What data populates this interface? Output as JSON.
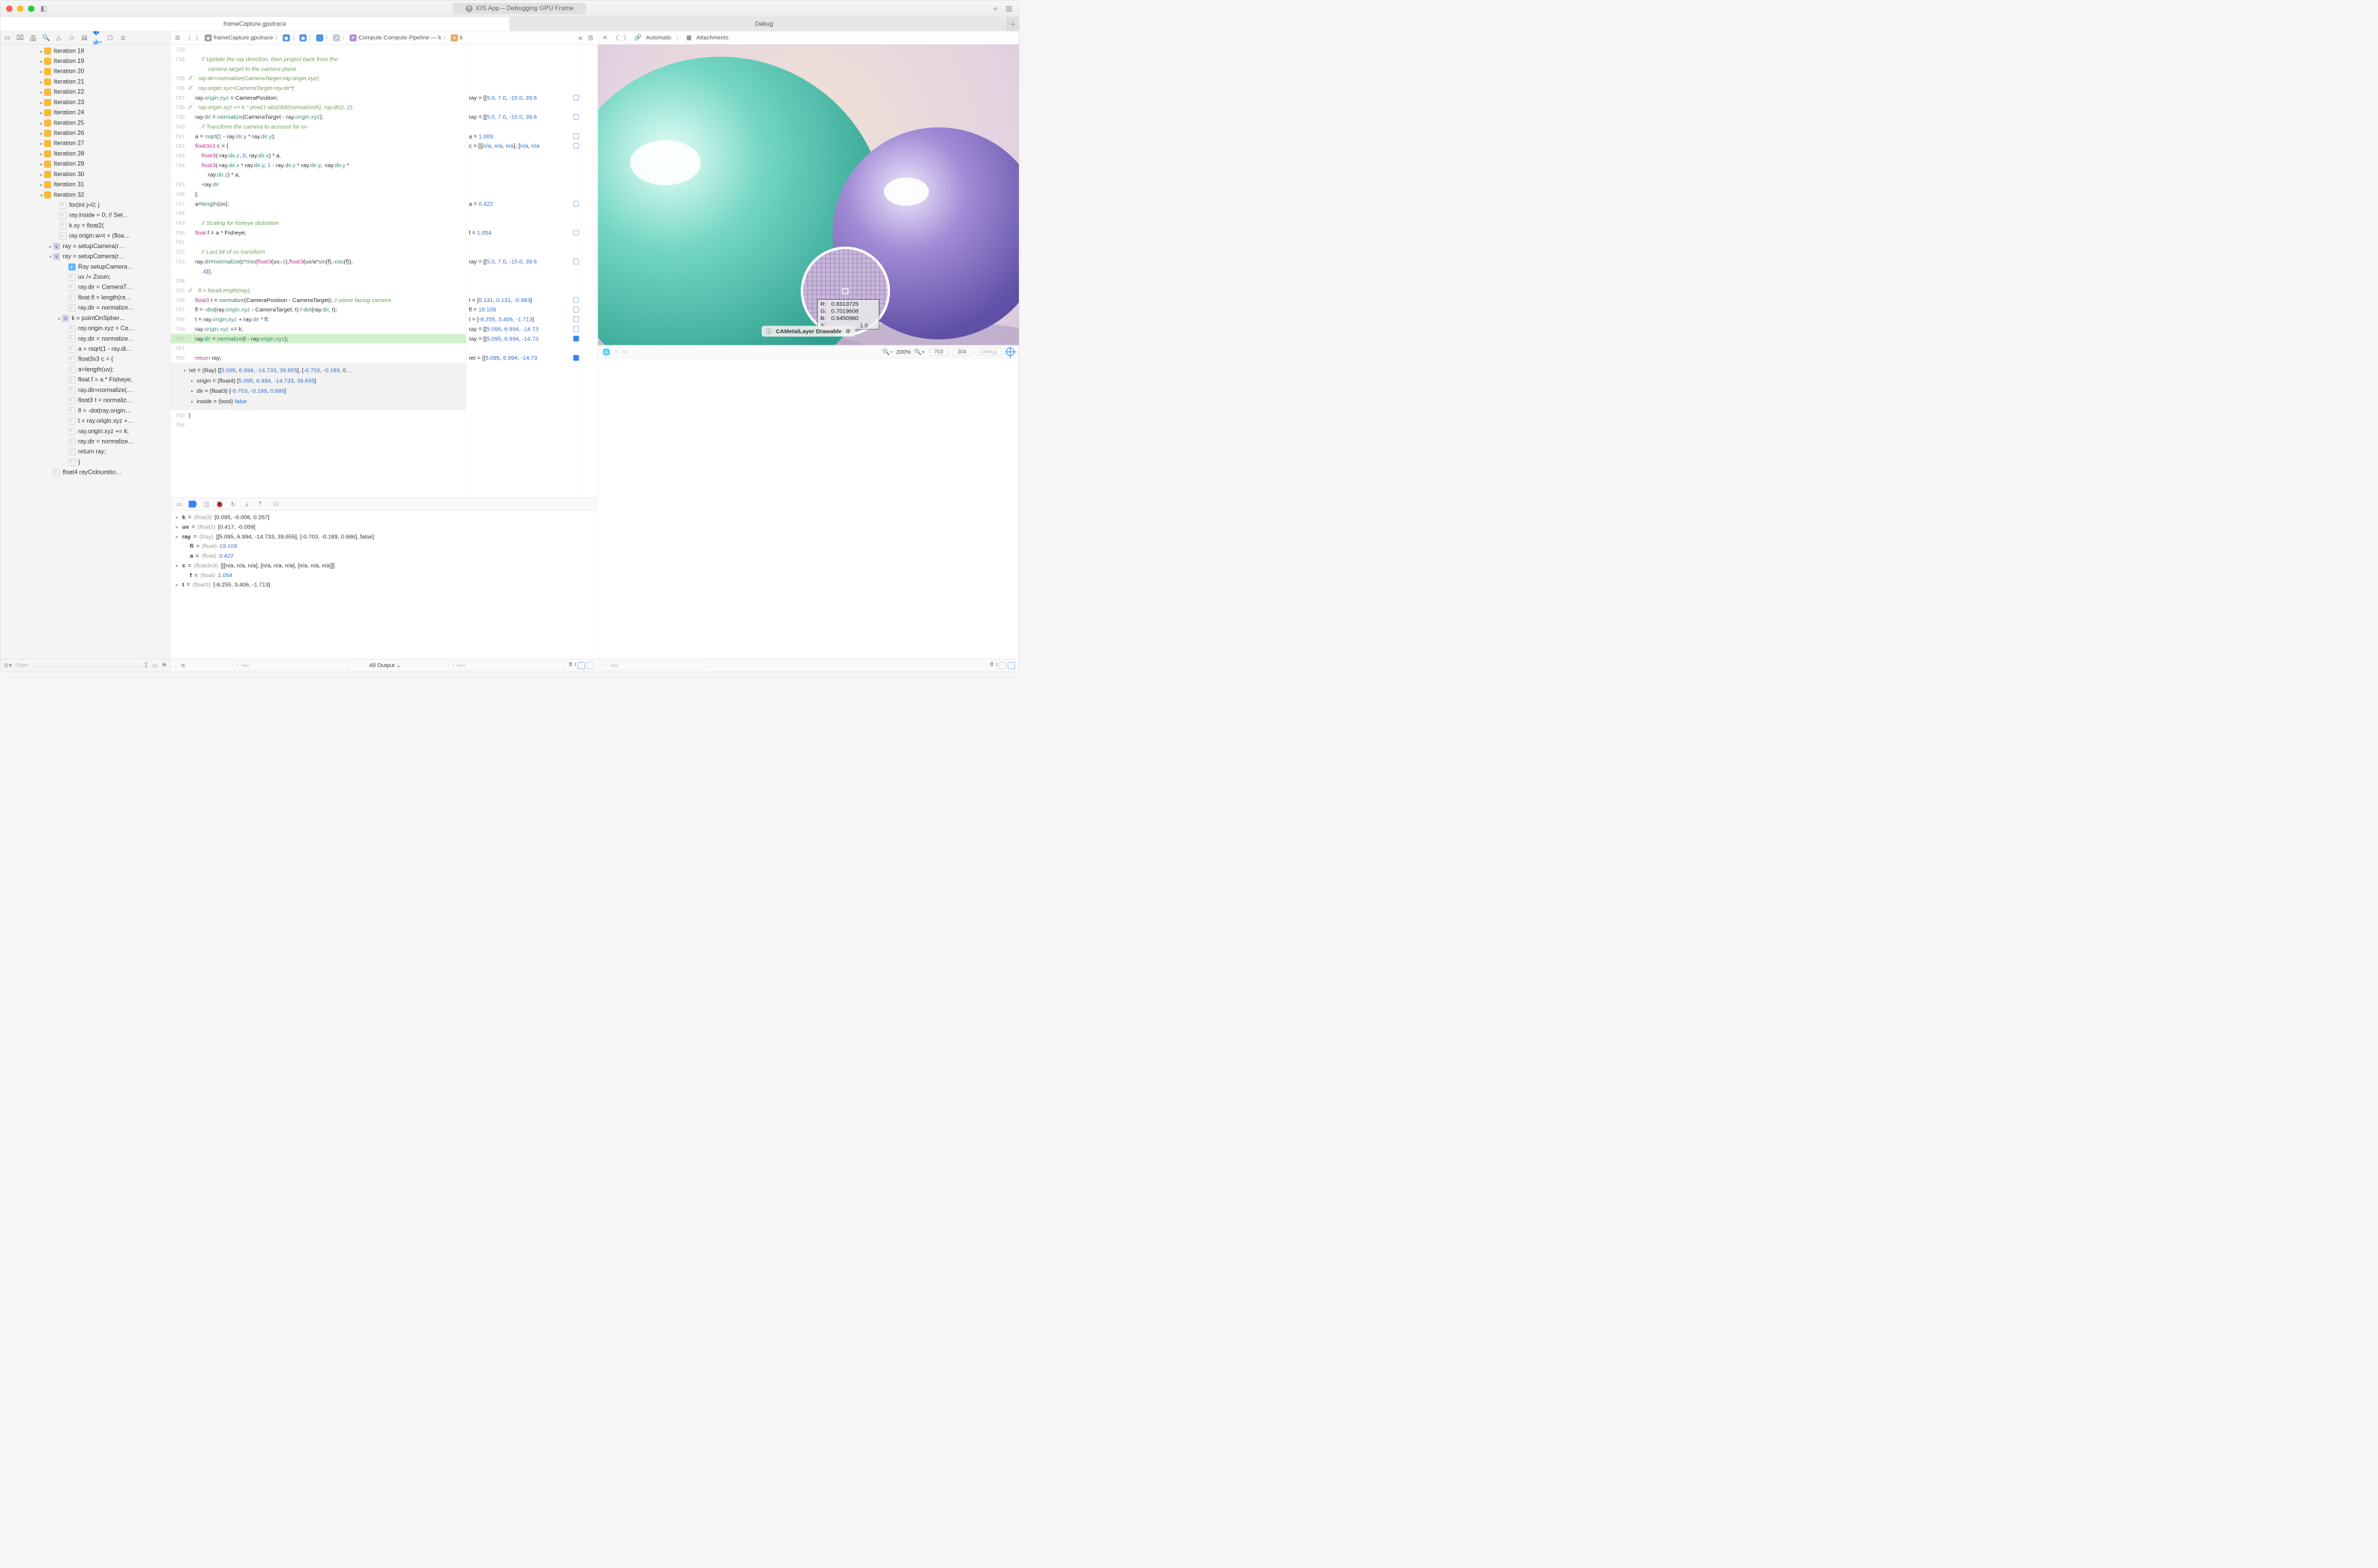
{
  "window": {
    "title": "iOS App – Debugging GPU Frame"
  },
  "tabs": {
    "left": "frameCapture.gputrace",
    "right": "Debug"
  },
  "nav": {
    "iterations": [
      "Iteration 18",
      "Iteration 19",
      "Iteration 20",
      "Iteration 21",
      "Iteration 22",
      "Iteration 23",
      "Iteration 24",
      "Iteration 25",
      "Iteration 26",
      "Iteration 27",
      "Iteration 28",
      "Iteration 29",
      "Iteration 30",
      "Iteration 31",
      "Iteration 32"
    ],
    "frame_items": [
      "for(int j=0; j<rayCou…",
      "ray.inside = 0; // Set…",
      "k.xy = float2(",
      "ray.origin.w=t + (floa…"
    ],
    "setup1": "ray = setupCamera(r…",
    "setup2": "ray = setupCamera(r…",
    "func": "Ray setupCamera…",
    "sub_items": [
      "uv /= Zoom;",
      "ray.dir = CameraT…",
      "float fl = length(ra…",
      "ray.dir = normalize…"
    ],
    "k_item": "k = pointOnSpher…",
    "tail_items": [
      "ray.origin.xyz = Ca…",
      "ray.dir = normalize…",
      "a = rsqrt(1 - ray.di…",
      "float3x3 c = {",
      "a=length(uv);",
      "float f = a * Fisheye;",
      "ray.dir=normalize(…",
      "float3 t = normaliz…",
      "fl = -dot(ray.origin…",
      "t = ray.origin.xyz +…",
      "ray.origin.xyz += k;",
      "ray.dir = normalize…",
      "return ray;",
      "}"
    ],
    "last": "float4 rayColouratio…",
    "filter_placeholder": "Filter"
  },
  "jumpbar": {
    "file": "frameCapture.gputrace",
    "pipeline": "Compute Compute Pipeline — k",
    "sym": "k"
  },
  "code": {
    "lines": [
      {
        "n": "733",
        "t": ""
      },
      {
        "n": "734",
        "t": "        // Update the ray direction, then project back from the",
        "cm": true
      },
      {
        "n": "",
        "t": "            camera target to the camera plane",
        "cm": true
      },
      {
        "n": "735",
        "t": "//    ray.dir=normalize(CameraTarget-ray.origin.xyz);",
        "cm": true
      },
      {
        "n": "736",
        "t": "//    ray.origin.xyz=CameraTarget-ray.dir*f;",
        "cm": true
      },
      {
        "n": "737",
        "t": "    ray.origin.xyz = CameraPosition;"
      },
      {
        "n": "738",
        "t": "//    ray.origin.xyz += k * pow(1-abs(dot(normalize(k), ray.dir)), 2);",
        "cm": true
      },
      {
        "n": "739",
        "t": "    ray.dir = normalize(CameraTarget - ray.origin.xyz);"
      },
      {
        "n": "740",
        "t": "        // Transform the camera to account for uv",
        "cm": true
      },
      {
        "n": "741",
        "t": "    a = rsqrt(1 - ray.dir.y * ray.dir.y);"
      },
      {
        "n": "742",
        "t": "    float3x3 c = {"
      },
      {
        "n": "743",
        "t": "        float3(-ray.dir.z, 0, ray.dir.x) * a,"
      },
      {
        "n": "744",
        "t": "        float3(-ray.dir.x * ray.dir.y, 1 - ray.dir.y * ray.dir.y, -ray.dir.y *"
      },
      {
        "n": "",
        "t": "            ray.dir.z) * a,"
      },
      {
        "n": "745",
        "t": "        -ray.dir"
      },
      {
        "n": "746",
        "t": "    };"
      },
      {
        "n": "747",
        "t": "    a=length(uv);"
      },
      {
        "n": "748",
        "t": ""
      },
      {
        "n": "749",
        "t": "        // Scaling for fisheye distortion",
        "cm": true
      },
      {
        "n": "750",
        "t": "    float f = a * Fisheye;"
      },
      {
        "n": "751",
        "t": ""
      },
      {
        "n": "752",
        "t": "        // Last bit of uv transform",
        "cm": true
      },
      {
        "n": "753",
        "t": "    ray.dir=normalize(c*mix(float3(uv,-1),float3(uv/a*sin(f),-cos(f)),"
      },
      {
        "n": "",
        "t": "        .4));"
      },
      {
        "n": "754",
        "t": ""
      },
      {
        "n": "755",
        "t": "//    fl = focalLength(ray);",
        "cm": true
      },
      {
        "n": "756",
        "t": "    float3 t = normalize(CameraPosition - CameraTarget); // plane facing camera"
      },
      {
        "n": "757",
        "t": "    fl = -dot(ray.origin.xyz - CameraTarget, t) / dot(ray.dir, t);"
      },
      {
        "n": "758",
        "t": "    t = ray.origin.xyz + ray.dir * fl;"
      },
      {
        "n": "759",
        "t": "    ray.origin.xyz += k;"
      },
      {
        "n": "760",
        "t": "    ray.dir = normalize(t - ray.origin.xyz);",
        "hl": true
      },
      {
        "n": "761",
        "t": ""
      },
      {
        "n": "762",
        "t": "    return ray;"
      }
    ],
    "tail": [
      {
        "n": "763",
        "t": "}"
      },
      {
        "n": "764",
        "t": ""
      }
    ]
  },
  "gutter": [
    {
      "t": "",
      "m": false
    },
    {
      "t": "",
      "m": false
    },
    {
      "t": "",
      "m": false
    },
    {
      "t": "",
      "m": false
    },
    {
      "t": "",
      "m": false
    },
    {
      "t": "ray = [[5.0, 7.0, -15.0, 39.6",
      "m": true
    },
    {
      "t": "",
      "m": false
    },
    {
      "t": "ray = [[5.0, 7.0, -15.0, 39.6",
      "m": true
    },
    {
      "t": "",
      "m": false
    },
    {
      "t": "a = 1.009",
      "m": true
    },
    {
      "t": "c = [[[n/a, n/a, n/a], [n/a, n/a",
      "m": true
    },
    {
      "t": "",
      "m": false
    },
    {
      "t": "",
      "m": false
    },
    {
      "t": "",
      "m": false
    },
    {
      "t": "",
      "m": false
    },
    {
      "t": "",
      "m": false
    },
    {
      "t": "a = 0.422",
      "m": true
    },
    {
      "t": "",
      "m": false
    },
    {
      "t": "",
      "m": false
    },
    {
      "t": "f = 1.054",
      "m": true
    },
    {
      "t": "",
      "m": false
    },
    {
      "t": "",
      "m": false
    },
    {
      "t": "ray = [[5.0, 7.0, -15.0, 39.6",
      "m": true
    },
    {
      "t": "",
      "m": false
    },
    {
      "t": "",
      "m": false
    },
    {
      "t": "",
      "m": false
    },
    {
      "t": "t = [0.131, 0.131, -0.983]",
      "m": true
    },
    {
      "t": "fl = 19.109",
      "m": true
    },
    {
      "t": "t = [-8.255, 3.406, -1.713]",
      "m": true
    },
    {
      "t": "ray = [[5.095, 6.994, -14.73",
      "m": true
    },
    {
      "t": "ray = [[5.095, 6.994, -14.73",
      "m": true,
      "blue": true
    },
    {
      "t": "",
      "m": false
    },
    {
      "t": "ret = [[5.095, 6.994, -14.73",
      "m": true,
      "blue": true
    }
  ],
  "ret": {
    "head": "ret = (Ray) [[5.095, 6.994, -14.733, 39.655], [-0.703, -0.189, 0…",
    "origin": "origin = (float4) [5.095, 6.994, -14.733, 39.655]",
    "dir": "dir = (float3) [-0.703, -0.189, 0.686]",
    "inside": "inside = (bool) false"
  },
  "vars": [
    {
      "ch": "▸",
      "name": "k",
      "ty": "(float3)",
      "val": "[0.095, -0.006, 0.267]"
    },
    {
      "ch": "▸",
      "name": "uv",
      "ty": "(float2)",
      "val": "[0.417, -0.059]"
    },
    {
      "ch": "▸",
      "name": "ray",
      "ty": "(Ray)",
      "val": "[[5.095, 6.994, -14.733, 39.655], [-0.703, -0.189, 0.686], false]"
    },
    {
      "ch": "",
      "name": "fl",
      "ty": "(float)",
      "val": "19.109",
      "ital": true,
      "ind": 1
    },
    {
      "ch": "",
      "name": "a",
      "ty": "(float)",
      "val": "0.422",
      "ital": true,
      "ind": 1
    },
    {
      "ch": "▸",
      "name": "c",
      "ty": "(float3x3)",
      "val": "[[[n/a, n/a, n/a], [n/a, n/a, n/a], [n/a, n/a, n/a]]]"
    },
    {
      "ch": "",
      "name": "f",
      "ty": "(float)",
      "val": "1.054",
      "ital": true,
      "ind": 1
    },
    {
      "ch": "▸",
      "name": "t",
      "ty": "(float3)",
      "val": "[-8.255, 3.406, -1.713]"
    }
  ],
  "bottom": {
    "all_output": "All Output",
    "filter_placeholder": "Filter"
  },
  "right": {
    "automatic": "Automatic",
    "attachments": "Attachments",
    "drawable": "CAMetalLayer Drawable",
    "zoom": "200%",
    "x": "703",
    "y": "304",
    "mode": "Debug",
    "pixel": {
      "R": "0.8313725",
      "G": "0.7019608",
      "B": "0.9450980",
      "A": "1.0"
    }
  }
}
